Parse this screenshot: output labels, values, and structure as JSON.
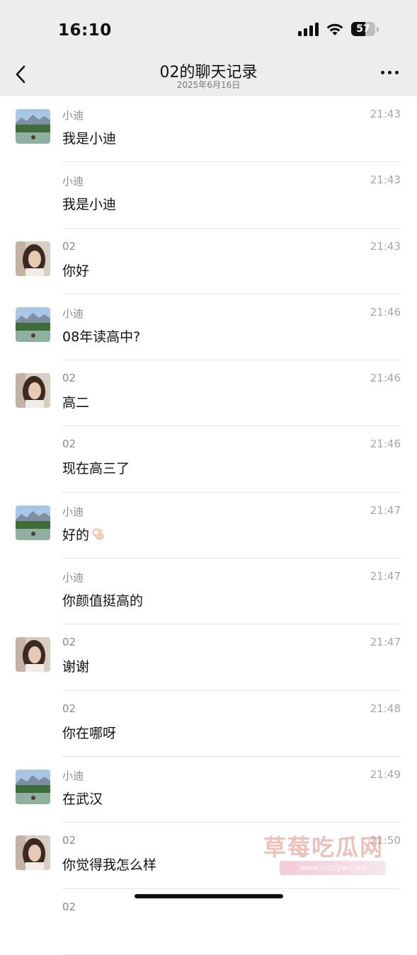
{
  "status_bar": {
    "time": "16:10",
    "battery": "57"
  },
  "nav": {
    "title": "02的聊天记录",
    "subtitle": "2025年6月16日"
  },
  "messages": [
    {
      "sender": "小迪",
      "time": "21:43",
      "text": "我是小迪",
      "avatar": "landscape-avatar"
    },
    {
      "sender": "小迪",
      "time": "21:43",
      "text": "我是小迪",
      "avatar": ""
    },
    {
      "sender": "02",
      "time": "21:43",
      "text": "你好",
      "avatar": "portrait-avatar"
    },
    {
      "sender": "小迪",
      "time": "21:46",
      "text": "08年读高中?",
      "avatar": "landscape-avatar"
    },
    {
      "sender": "02",
      "time": "21:46",
      "text": "高二",
      "avatar": "portrait-avatar"
    },
    {
      "sender": "02",
      "time": "21:46",
      "text": "现在高三了",
      "avatar": ""
    },
    {
      "sender": "小迪",
      "time": "21:47",
      "text": "好的",
      "emoji": "ok-hand-emoji",
      "avatar": "landscape-avatar"
    },
    {
      "sender": "小迪",
      "time": "21:47",
      "text": "你颜值挺高的",
      "avatar": ""
    },
    {
      "sender": "02",
      "time": "21:47",
      "text": "谢谢",
      "avatar": "portrait-avatar"
    },
    {
      "sender": "02",
      "time": "21:48",
      "text": "你在哪呀",
      "avatar": ""
    },
    {
      "sender": "小迪",
      "time": "21:49",
      "text": "在武汉",
      "avatar": "landscape-avatar"
    },
    {
      "sender": "02",
      "time": "21:50",
      "text": "你觉得我怎么样",
      "avatar": "portrait-avatar"
    },
    {
      "sender": "02",
      "time": "",
      "text": "",
      "avatar": ""
    }
  ],
  "watermark": {
    "text": "草莓吃瓜网",
    "url": "www.cmcgw.com"
  },
  "colors": {
    "header_bg": "#ededed",
    "divider": "#e6e6e6",
    "secondary_text": "#8a8a8a"
  }
}
